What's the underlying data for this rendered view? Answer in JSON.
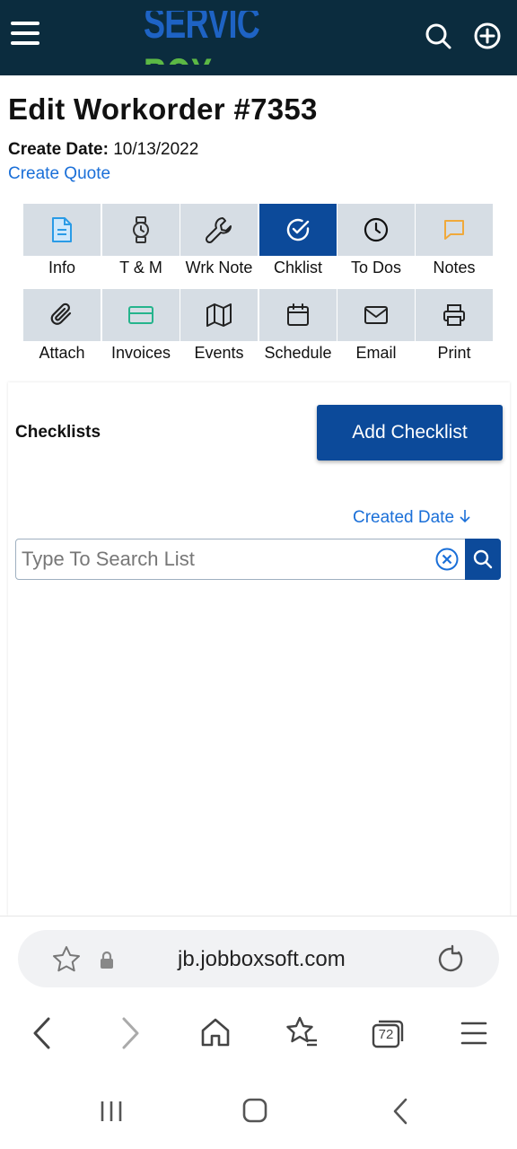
{
  "header": {
    "logo_part1": "SERVICE",
    "logo_part2": "BOX",
    "colors": {
      "bar": "#0b2c3e",
      "logo_service": "#1e63c4",
      "logo_box": "#5cb845"
    }
  },
  "page": {
    "title": "Edit Workorder #7353",
    "create_date_label": "Create Date:",
    "create_date_value": "10/13/2022",
    "create_quote_link": "Create Quote"
  },
  "tabs_row1": [
    {
      "label": "Info",
      "icon": "document-icon"
    },
    {
      "label": "T & M",
      "icon": "watch-icon"
    },
    {
      "label": "Wrk Note",
      "icon": "wrench-icon"
    },
    {
      "label": "Chklist",
      "icon": "check-circle-icon",
      "active": true
    },
    {
      "label": "To Dos",
      "icon": "clock-icon"
    },
    {
      "label": "Notes",
      "icon": "speech-bubble-icon"
    }
  ],
  "tabs_row2": [
    {
      "label": "Attach",
      "icon": "paperclip-icon"
    },
    {
      "label": "Invoices",
      "icon": "credit-card-icon"
    },
    {
      "label": "Events",
      "icon": "map-icon"
    },
    {
      "label": "Schedule",
      "icon": "calendar-icon"
    },
    {
      "label": "Email",
      "icon": "envelope-icon"
    },
    {
      "label": "Print",
      "icon": "printer-icon"
    }
  ],
  "checklists": {
    "section_label": "Checklists",
    "add_button": "Add Checklist",
    "sort_label": "Created Date",
    "search_placeholder": "Type To Search List"
  },
  "browser": {
    "url": "jb.jobboxsoft.com",
    "tab_count": "72"
  },
  "colors": {
    "primary": "#0c4a9a",
    "link": "#1a6fd8",
    "tile_bg": "#d6dde4"
  }
}
